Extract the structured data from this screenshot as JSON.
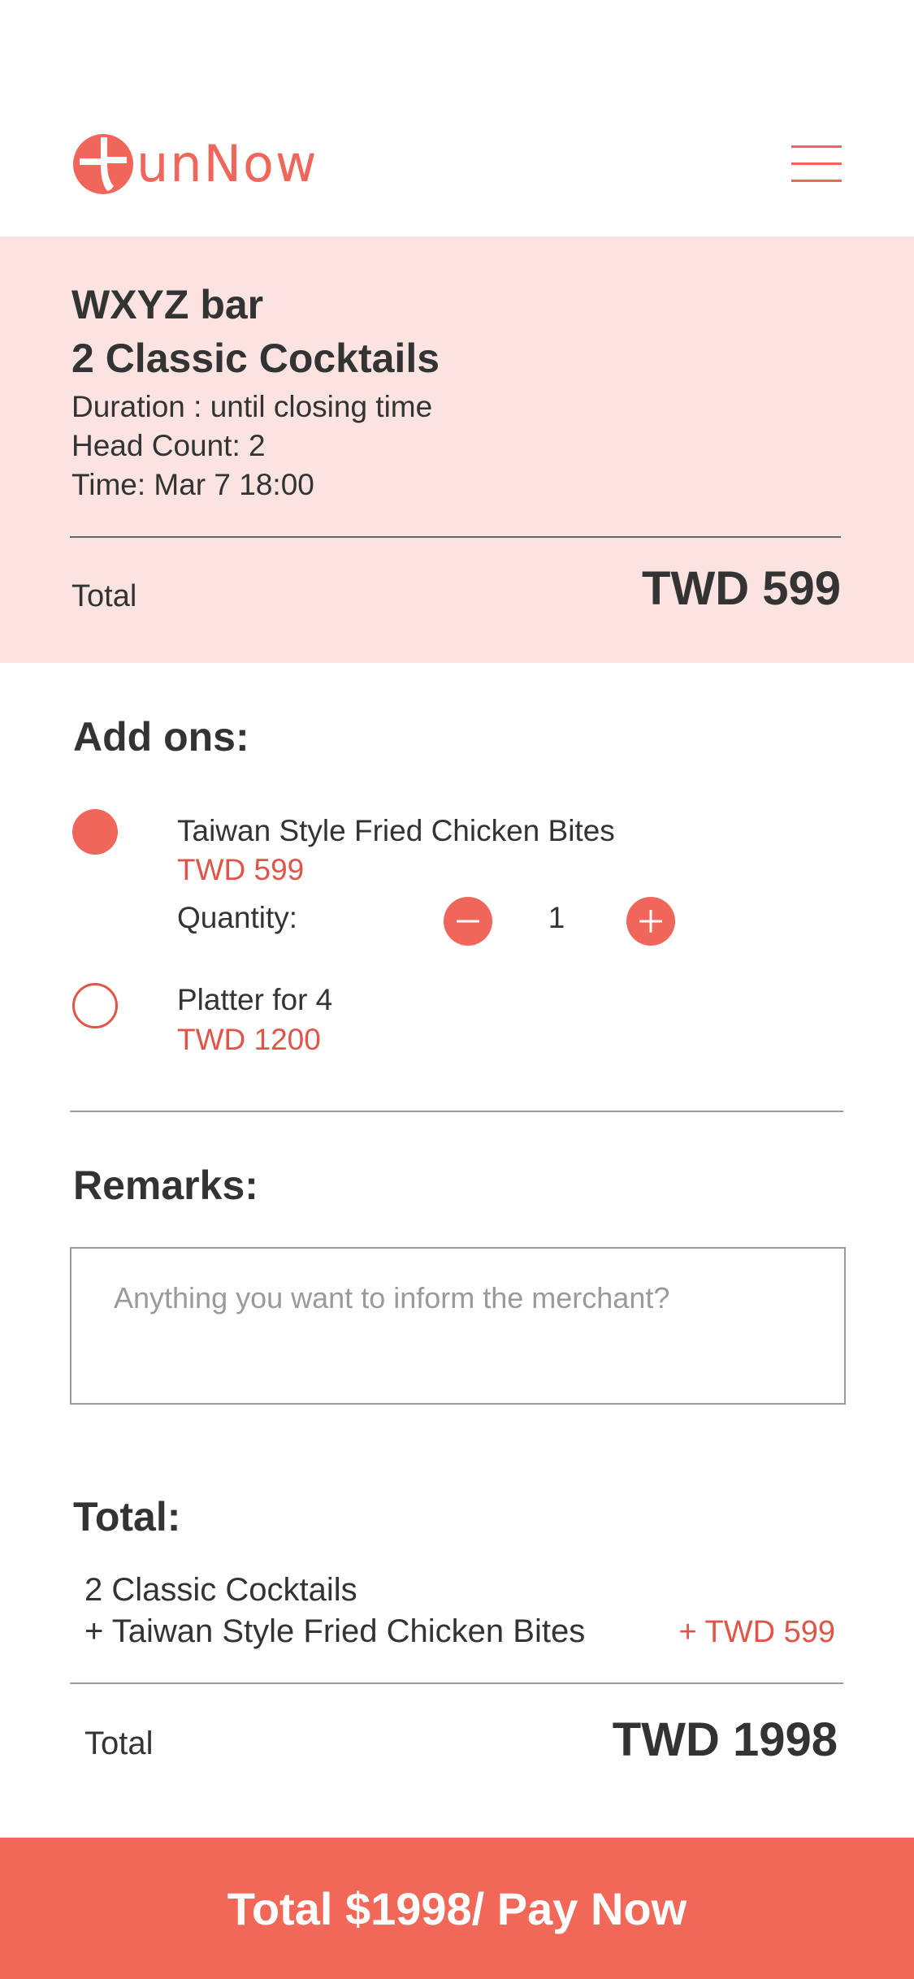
{
  "brand": {
    "logo_text": "unNow",
    "accent_color": "#f0665a",
    "menu_icon": "hamburger-menu-icon"
  },
  "order": {
    "venue": "WXYZ bar",
    "package": "2 Classic Cocktails",
    "duration": "Duration : until closing time",
    "head_count": "Head Count: 2",
    "time": "Time: Mar 7 18:00",
    "total_label": "Total",
    "total_value": "TWD 599"
  },
  "addons": {
    "title": "Add ons:",
    "items": [
      {
        "name": "Taiwan Style Fried Chicken Bites",
        "price": "TWD 599",
        "selected": true
      },
      {
        "name": "Platter for 4",
        "price": "TWD 1200",
        "selected": false
      }
    ],
    "quantity_label": "Quantity:",
    "quantity_value": "1"
  },
  "remarks": {
    "title": "Remarks:",
    "placeholder": "Anything you want to inform the merchant?",
    "value": ""
  },
  "summary": {
    "title": "Total:",
    "line1": "2 Classic Cocktails",
    "line2": "+ Taiwan Style Fried Chicken Bites",
    "line2_price": "+ TWD 599",
    "total_label": "Total",
    "total_value": "TWD 1998"
  },
  "pay_button": {
    "label": "Total $1998/ Pay Now",
    "color": "#f26858"
  }
}
